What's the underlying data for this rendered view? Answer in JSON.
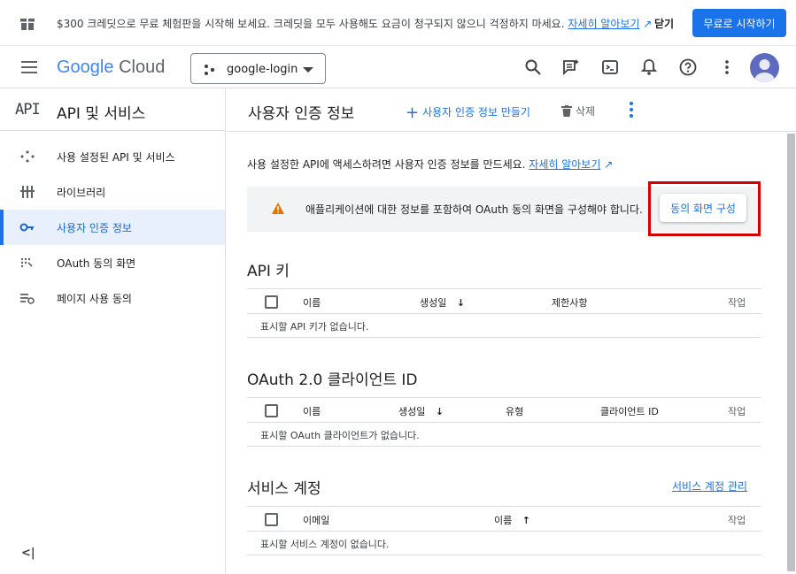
{
  "banner": {
    "message": "$300 크레딧으로 무료 체험판을 시작해 보세요. 크레딧을 모두 사용해도 요금이 청구되지 않으니 걱정하지 마세요.",
    "link": "자세히 알아보기",
    "dismiss": "닫기",
    "cta": "무료로 시작하기"
  },
  "topbar": {
    "logo_google": "Google",
    "logo_cloud": "Cloud",
    "project": "google-login"
  },
  "sidebar": {
    "api_icon_text": "API",
    "title": "API 및 서비스",
    "items": [
      {
        "label": "사용 설정된 API 및 서비스",
        "icon": "apis-icon"
      },
      {
        "label": "라이브러리",
        "icon": "library-icon"
      },
      {
        "label": "사용자 인증 정보",
        "icon": "key-icon"
      },
      {
        "label": "OAuth 동의 화면",
        "icon": "oauth-icon"
      },
      {
        "label": "페이지 사용 동의",
        "icon": "settings-list-icon"
      }
    ],
    "collapse": "<|"
  },
  "main": {
    "title": "사용자 인증 정보",
    "create": "사용자 인증 정보 만들기",
    "delete": "삭제",
    "intro": "사용 설정한 API에 액세스하려면 사용자 인증 정보를 만드세요.",
    "intro_link": "자세히 알아보기",
    "notice": "애플리케이션에 대한 정보를 포함하여 OAuth 동의 화면을 구성해야 합니다.",
    "notice_button": "동의 화면 구성",
    "api_keys": {
      "title": "API 키",
      "columns": [
        "이름",
        "생성일",
        "제한사항",
        "작업"
      ],
      "empty": "표시할 API 키가 없습니다."
    },
    "oauth": {
      "title": "OAuth 2.0 클라이언트 ID",
      "columns": [
        "이름",
        "생성일",
        "유형",
        "클라이언트 ID",
        "작업"
      ],
      "empty": "표시할 OAuth 클라이언트가 없습니다."
    },
    "service_accounts": {
      "title": "서비스 계정",
      "manage": "서비스 계정 관리",
      "columns": [
        "이메일",
        "이름",
        "작업"
      ],
      "empty": "표시할 서비스 계정이 없습니다."
    }
  },
  "colors": {
    "accent": "#1a73e8",
    "highlight": "#d50000",
    "warning": "#e37400"
  }
}
